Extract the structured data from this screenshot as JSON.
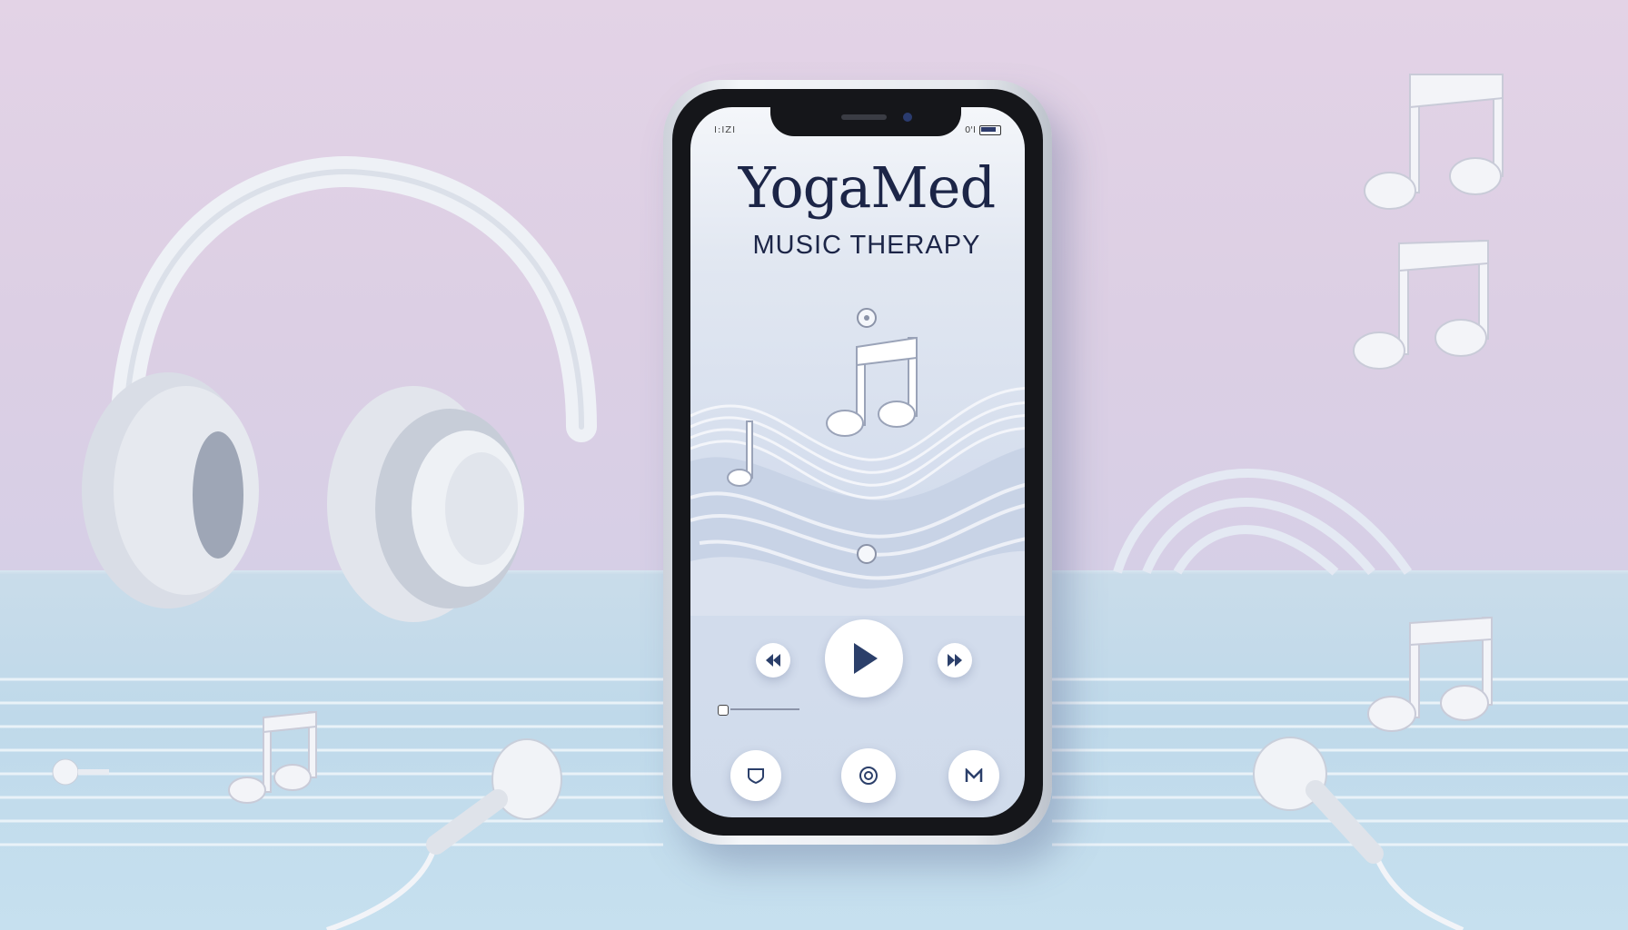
{
  "app": {
    "brand": "YogaMed",
    "tagline": "MUSIC THERAPY"
  },
  "status_bar": {
    "left_text": "I:IZI",
    "right_text": "0'I"
  },
  "player": {
    "controls": [
      "previous",
      "play",
      "next"
    ],
    "progress": 0.0
  },
  "icons": {
    "top_indicator": "dot-icon",
    "main_note": "music-note-icon",
    "dock": [
      "shield-icon",
      "target-icon",
      "m-icon"
    ]
  },
  "colors": {
    "brand_text": "#1c2547",
    "wall": "#dccfe4",
    "desk": "#c6e0ef",
    "play_icon": "#2b3f6a"
  }
}
